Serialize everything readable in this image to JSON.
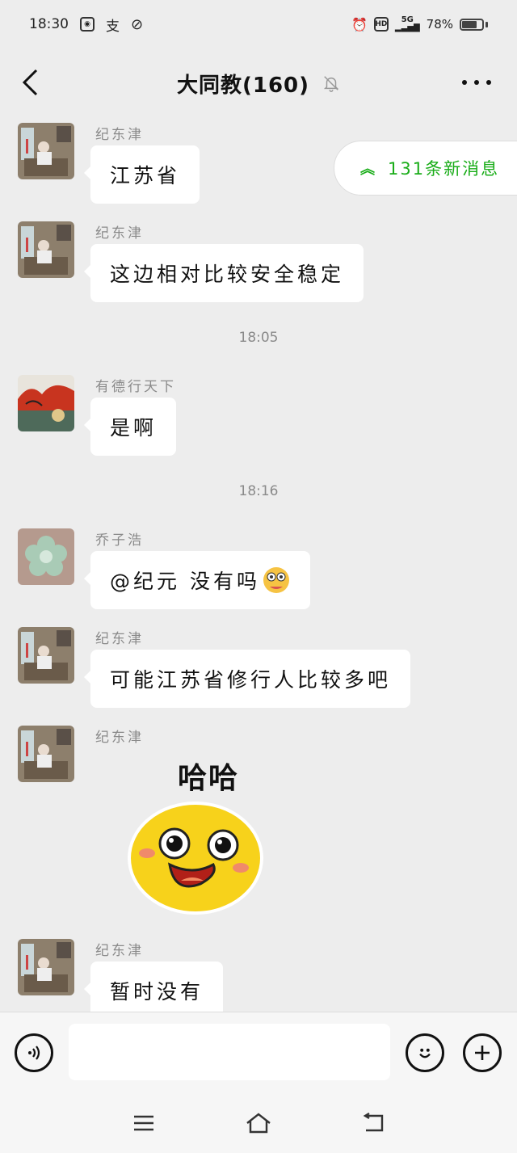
{
  "status_bar": {
    "time": "18:30",
    "battery": "78%",
    "network": "5G",
    "hd": "HD"
  },
  "header": {
    "title": "大同教(160)",
    "more_icon": "more-icon",
    "mute_icon": "mute-bell-icon"
  },
  "new_messages": {
    "label": "131条新消息",
    "icon": "double-chevron-up-icon",
    "color": "#1aad19"
  },
  "messages": [
    {
      "sender": "纪东津",
      "text": "江苏省"
    },
    {
      "sender": "纪东津",
      "text": "这边相对比较安全稳定"
    },
    {
      "sender": "有德行天下",
      "text": "是啊"
    },
    {
      "sender": "乔子浩",
      "text": "@纪元 没有吗"
    },
    {
      "sender": "纪东津",
      "text": "可能江苏省修行人比较多吧"
    },
    {
      "sender": "纪东津",
      "sticker_text": "哈哈"
    },
    {
      "sender": "纪东津",
      "text": "暂时没有"
    }
  ],
  "time_separators": [
    "18:05",
    "18:16"
  ],
  "input": {
    "value": "",
    "voice_icon": "voice-icon",
    "emoji_icon": "emoji-icon",
    "plus_icon": "plus-icon"
  },
  "system_nav": {
    "menu_icon": "menu-icon",
    "home_icon": "home-icon",
    "back_icon": "back-icon"
  }
}
